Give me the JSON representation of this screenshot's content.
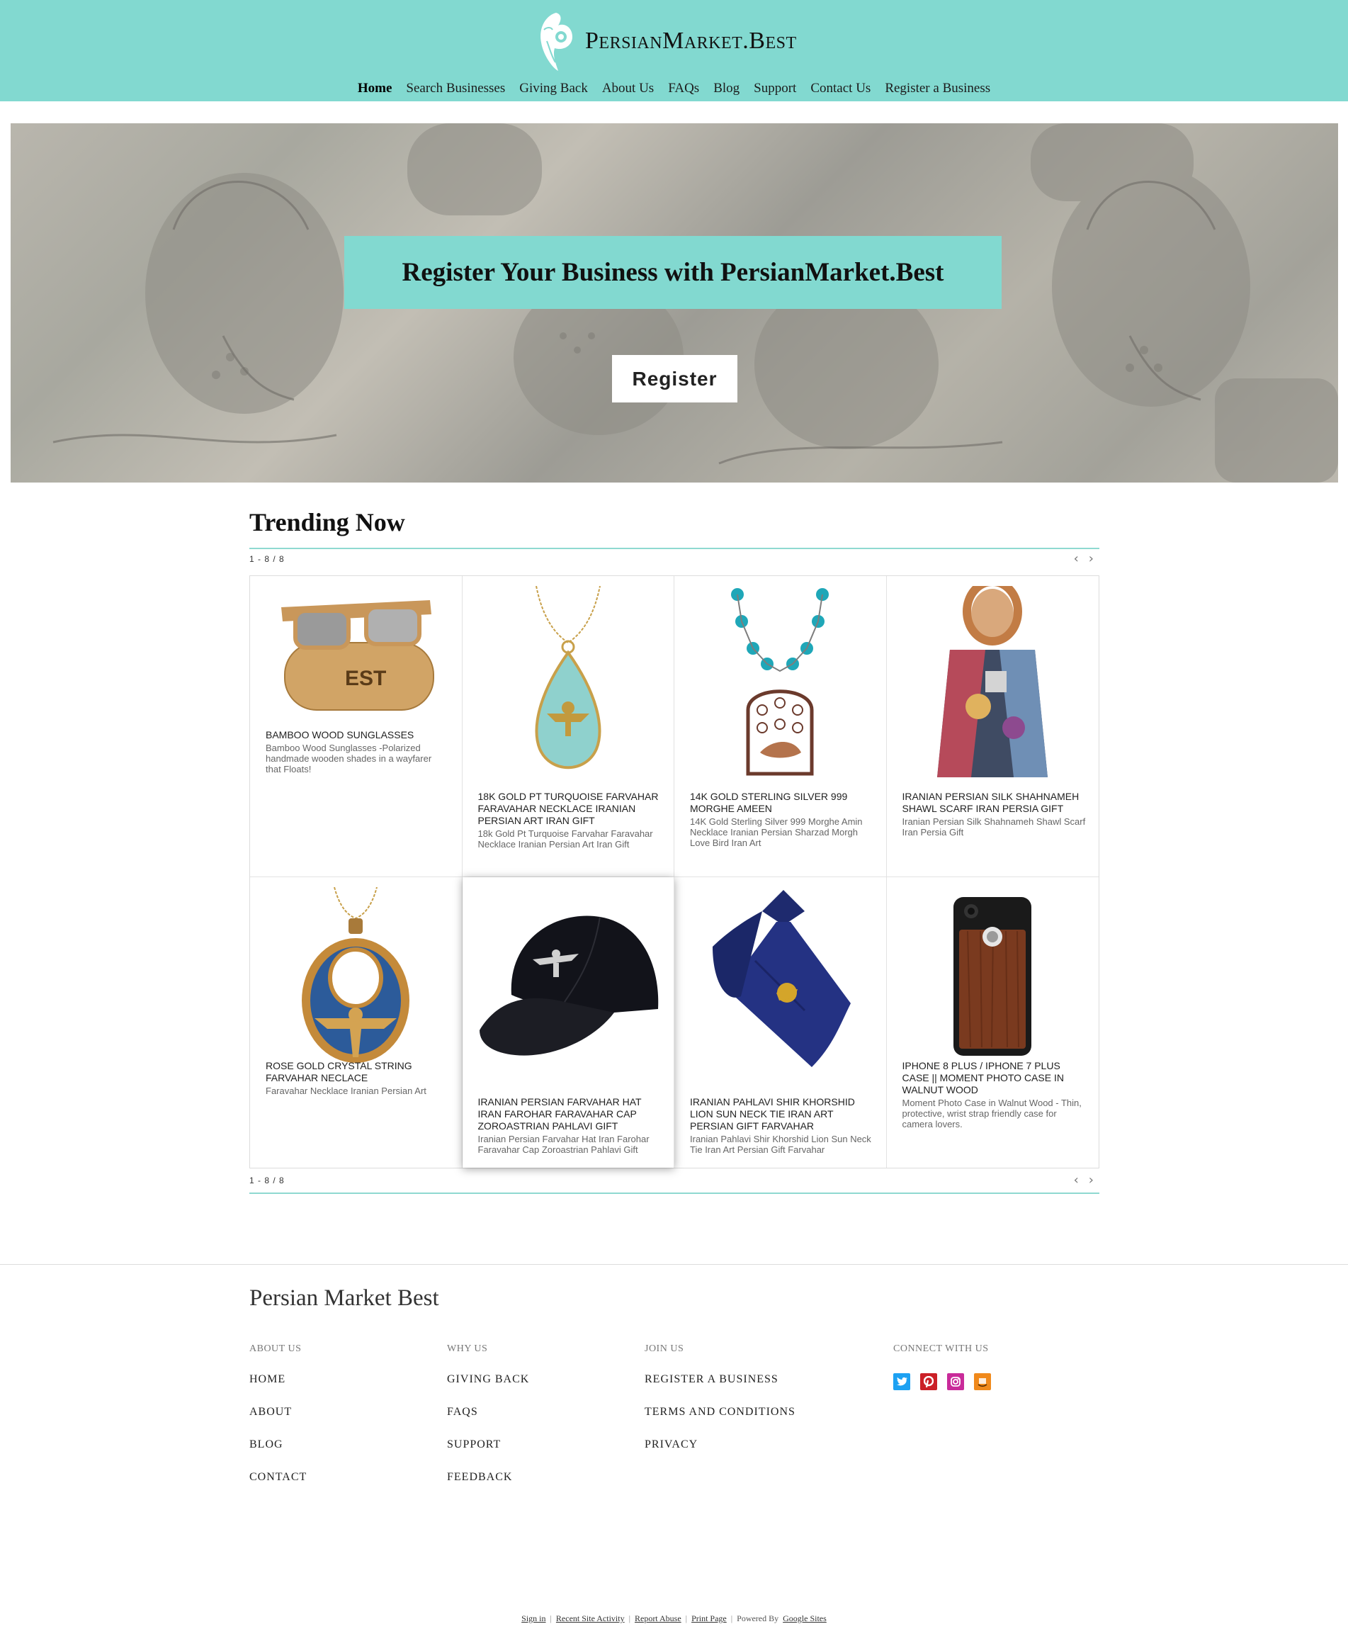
{
  "header": {
    "brand": "PersianMarket.Best",
    "nav": [
      "Home",
      "Search Businesses",
      "Giving Back",
      "About Us",
      "FAQs",
      "Blog",
      "Support",
      "Contact Us",
      "Register a Business"
    ],
    "active_nav": "Home"
  },
  "hero": {
    "title": "Register Your Business with PersianMarket.Best",
    "button_label": "Register"
  },
  "trending": {
    "title": "Trending Now",
    "count_label": "1 - 8 / 8",
    "products": [
      {
        "title": "BAMBOO WOOD SUNGLASSES",
        "desc": "Bamboo Wood Sunglasses -Polarized handmade wooden shades in a wayfarer that Floats!",
        "icon": "sunglasses-icon"
      },
      {
        "title": "18K GOLD PT TURQUOISE FARVAHAR FARAVAHAR NECKLACE IRANIAN PERSIAN ART IRAN GIFT",
        "desc": "18k Gold Pt Turquoise Farvahar Faravahar Necklace Iranian Persian Art Iran Gift",
        "icon": "turquoise-necklace-icon"
      },
      {
        "title": "14K GOLD STERLING SILVER 999 MORGHE AMEEN",
        "desc": "14K Gold Sterling Silver 999 Morghe Amin Necklace Iranian Persian Sharzad Morgh Love Bird Iran Art",
        "icon": "bird-necklace-icon"
      },
      {
        "title": "IRANIAN PERSIAN SILK SHAHNAMEH SHAWL SCARF IRAN PERSIA GIFT",
        "desc": "Iranian Persian Silk Shahnameh Shawl Scarf Iran Persia Gift",
        "icon": "silk-scarf-icon"
      },
      {
        "title": "ROSE GOLD CRYSTAL STRING FARVAHAR NECLACE",
        "desc": "Faravahar Necklace Iranian Persian Art",
        "icon": "farvahar-necklace-icon"
      },
      {
        "title": "IRANIAN PERSIAN FARVAHAR HAT IRAN FAROHAR FARAVAHAR CAP ZOROASTRIAN PAHLAVI GIFT",
        "desc": "Iranian Persian Farvahar Hat Iran Farohar Faravahar Cap Zoroastrian Pahlavi Gift",
        "icon": "cap-icon"
      },
      {
        "title": "IRANIAN PAHLAVI SHIR KHORSHID LION SUN NECK TIE IRAN ART PERSIAN GIFT FARVAHAR",
        "desc": "Iranian Pahlavi Shir Khorshid Lion Sun Neck Tie Iran Art Persian Gift Farvahar",
        "icon": "neck-tie-icon"
      },
      {
        "title": "IPHONE 8 PLUS / IPHONE 7 PLUS CASE || MOMENT PHOTO CASE IN WALNUT WOOD",
        "desc": "Moment Photo Case in Walnut Wood - Thin, protective, wrist strap friendly case for camera lovers.",
        "icon": "phone-case-icon"
      }
    ]
  },
  "footer": {
    "brand": "Persian Market Best",
    "columns": [
      {
        "heading": "ABOUT US",
        "links": [
          "HOME",
          "ABOUT",
          "BLOG",
          "CONTACT"
        ]
      },
      {
        "heading": "WHY US",
        "links": [
          "GIVING BACK",
          "FAQS",
          "SUPPORT",
          "FEEDBACK"
        ]
      },
      {
        "heading": "JOIN US",
        "links": [
          "REGISTER A BUSINESS",
          "TERMS AND CONDITIONS",
          "PRIVACY"
        ]
      },
      {
        "heading": "CONNECT WITH US",
        "links": []
      }
    ],
    "social": [
      {
        "icon": "twitter-icon",
        "color": "#1da1f2"
      },
      {
        "icon": "pinterest-icon",
        "color": "#cb2027"
      },
      {
        "icon": "instagram-icon",
        "color": "#c92b9a"
      },
      {
        "icon": "amazon-icon",
        "color": "#f0891b"
      }
    ]
  },
  "bottom_bar": {
    "links": [
      "Sign in",
      "Recent Site Activity",
      "Report Abuse",
      "Print Page"
    ],
    "powered_prefix": "Powered By",
    "powered_link": "Google Sites"
  },
  "colors": {
    "accent": "#82d9d0",
    "pager_line": "#8fd9d1"
  }
}
